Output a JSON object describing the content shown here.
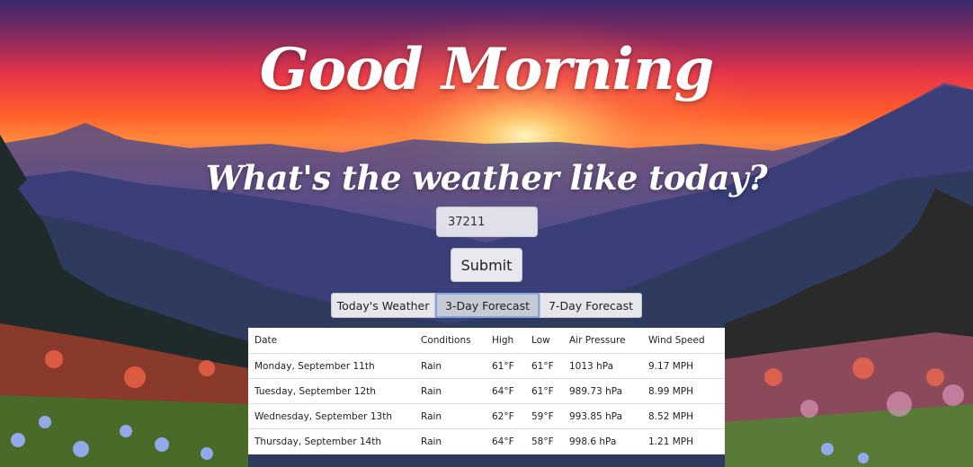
{
  "greeting": "Good Morning",
  "question": "What's the weather like today?",
  "zip_input": {
    "value": "37211",
    "placeholder": ""
  },
  "submit_label": "Submit",
  "tabs": [
    {
      "label": "Today's Weather",
      "active": false
    },
    {
      "label": "3-Day Forecast",
      "active": true
    },
    {
      "label": "7-Day Forecast",
      "active": false
    }
  ],
  "forecast_table": {
    "headers": [
      "Date",
      "Conditions",
      "High",
      "Low",
      "Air Pressure",
      "Wind Speed"
    ],
    "rows": [
      [
        "Monday, September 11th",
        "Rain",
        "61°F",
        "61°F",
        "1013 hPa",
        "9.17 MPH"
      ],
      [
        "Tuesday, September 12th",
        "Rain",
        "64°F",
        "61°F",
        "989.73 hPa",
        "8.99 MPH"
      ],
      [
        "Wednesday, September 13th",
        "Rain",
        "62°F",
        "59°F",
        "993.85 hPa",
        "8.52 MPH"
      ],
      [
        "Thursday, September 14th",
        "Rain",
        "64°F",
        "58°F",
        "998.6 hPa",
        "1.21 MPH"
      ]
    ]
  },
  "colors": {
    "sky_top": "#3a2a6e",
    "sky_glow": "#ff5a2a",
    "sun": "#fff1a8",
    "mountains": "#3b3f7a",
    "meadow": "#4a6a2a",
    "active_tab_border": "#7fa8d8"
  }
}
